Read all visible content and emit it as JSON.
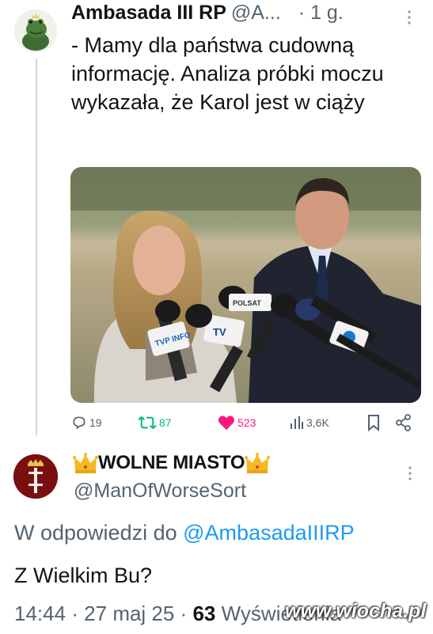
{
  "tweet1": {
    "author_name": "Ambasada III RP",
    "author_handle": "@A...",
    "time": "· 1 g.",
    "text": "- Mamy dla państwa cudowną informację. Analiza próbki moczu wykazała, że Karol jest w ciąży",
    "mic_labels": [
      "TVP INFO",
      "TV",
      "POLSAT"
    ],
    "actions": {
      "reply_count": "19",
      "retweet_count": "87",
      "like_count": "523",
      "views_count": "3,6K"
    },
    "colors": {
      "retweet": "#00ba7c",
      "like": "#f91880",
      "secondary": "#536471"
    }
  },
  "tweet2": {
    "author_name": "WOLNE MIASTO",
    "author_handle": "@ManOfWorseSort",
    "reply_to_prefix": "W odpowiedzi do",
    "reply_to_mention": "@AmbasadaIIIRP",
    "text": "Z Wielkim Bu?",
    "timestamp": "14:44 · 27 maj 25 · ",
    "views_count": "63",
    "views_label": " Wyświetlenia",
    "colors": {
      "mention": "#1d9bf0"
    }
  },
  "watermark": "www.wiocha.pl"
}
